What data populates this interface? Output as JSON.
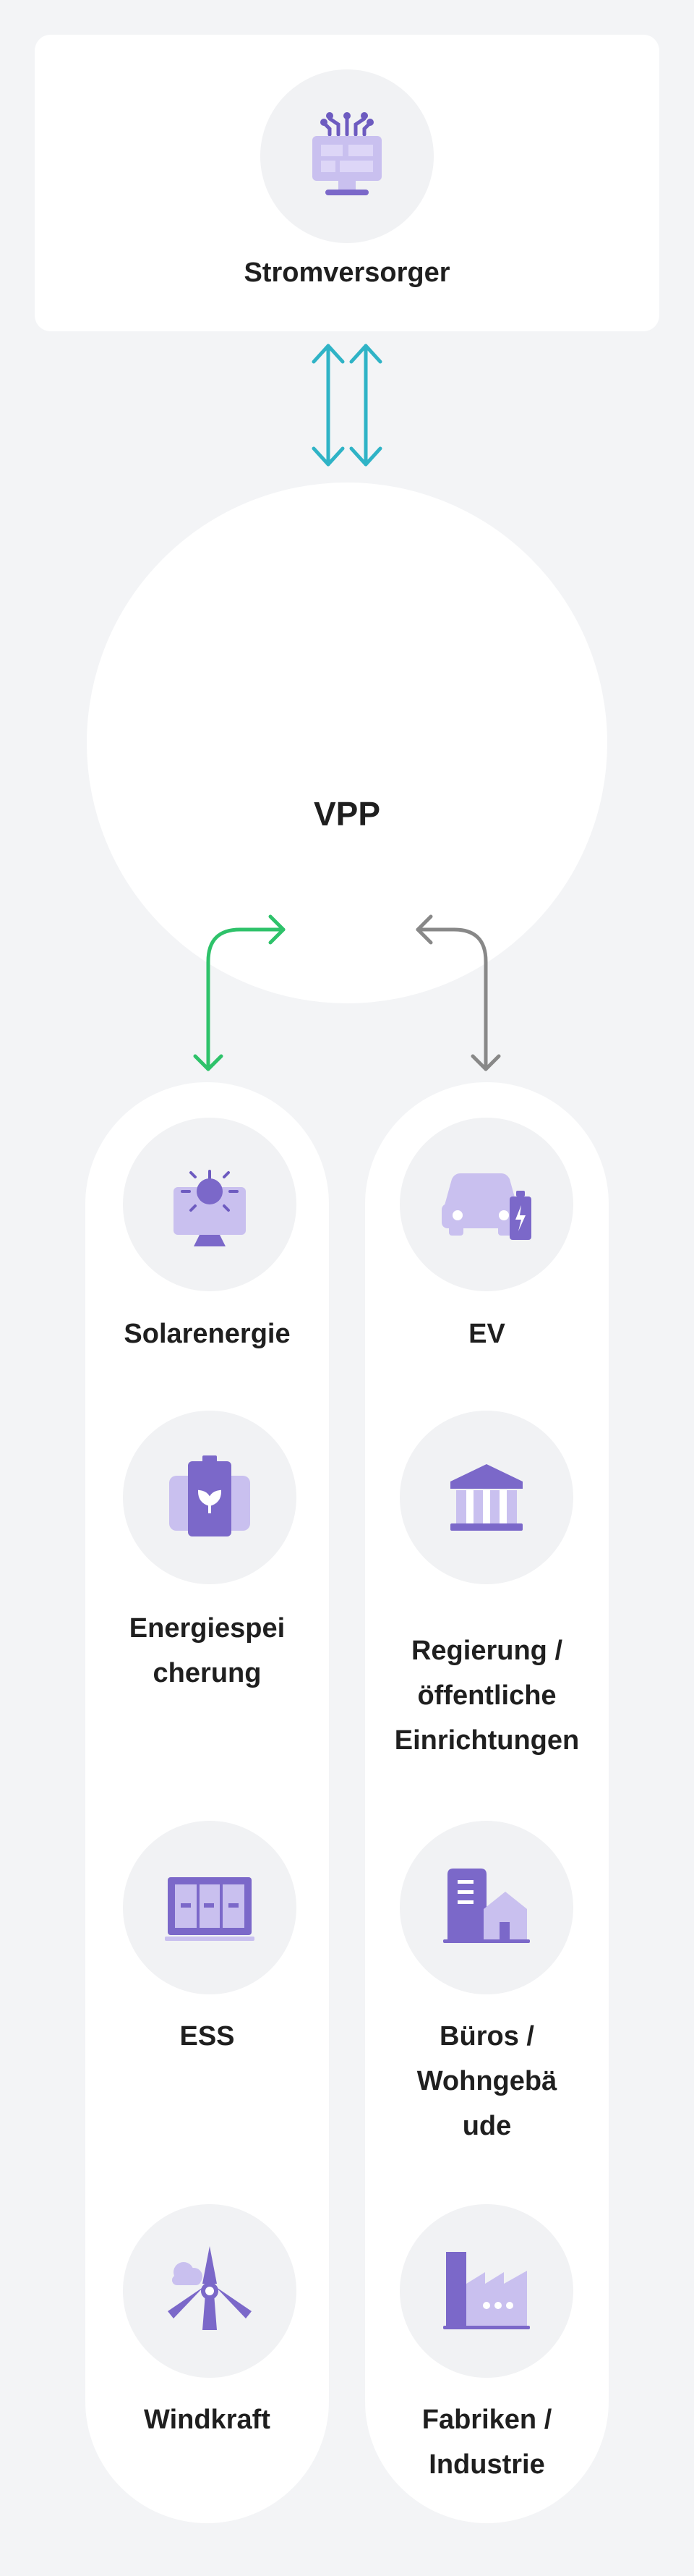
{
  "utility": {
    "label": "Stromversorger",
    "icon": "utility-monitor-icon"
  },
  "vpp": {
    "label": "VPP"
  },
  "left_column": {
    "items": [
      {
        "label_lines": [
          "Solarenergie"
        ],
        "icon": "solar-panel-icon"
      },
      {
        "label_lines": [
          "Energiespei",
          "cherung"
        ],
        "icon": "battery-leaf-icon"
      },
      {
        "label_lines": [
          "ESS"
        ],
        "icon": "ess-cabinet-icon"
      },
      {
        "label_lines": [
          "Windkraft"
        ],
        "icon": "wind-turbine-icon"
      }
    ]
  },
  "right_column": {
    "items": [
      {
        "label_lines": [
          "EV"
        ],
        "icon": "electric-car-icon"
      },
      {
        "label_lines": [
          "Regierung /",
          "öffentliche",
          "Einrichtungen"
        ],
        "icon": "government-building-icon"
      },
      {
        "label_lines": [
          "Büros /",
          "Wohngebä",
          "ude"
        ],
        "icon": "office-house-icon"
      },
      {
        "label_lines": [
          "Fabriken /",
          "Industrie"
        ],
        "icon": "factory-icon"
      }
    ]
  },
  "colors": {
    "background": "#f3f4f6",
    "card": "#ffffff",
    "icon_circle": "#f1f2f4",
    "icon_primary": "#7b68c9",
    "icon_light": "#c9c0ef",
    "arrow_teal": "#2fb3c6",
    "arrow_green": "#2ec26a",
    "arrow_gray": "#888888",
    "text": "#1f1f1f"
  }
}
